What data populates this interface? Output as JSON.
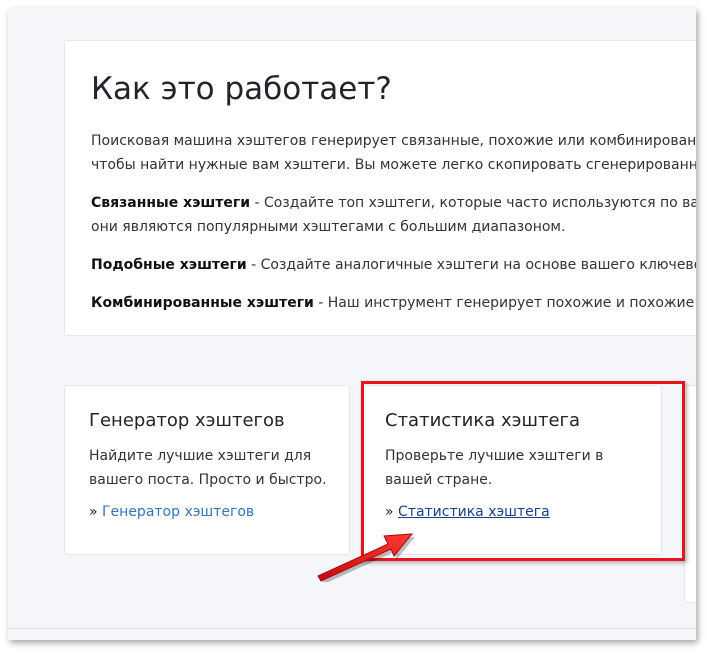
{
  "how_it_works": {
    "title": "Как это работает?",
    "intro_line1": "Поисковая машина хэштегов генерирует связанные, похожие или комбинированные",
    "intro_line2": "чтобы найти нужные вам хэштеги. Вы можете легко скопировать сгенерированные х",
    "related_term": "Связанные хэштеги",
    "related_desc_line1": " - Создайте топ хэштеги, которые часто используются по вашему",
    "related_desc_line2": "они являются популярными хэштегами с большим диапазоном.",
    "similar_term": "Подобные хэштеги",
    "similar_desc": " - Создайте аналогичные хэштеги на основе вашего ключевого сл",
    "combined_term": "Комбинированные хэштеги",
    "combined_desc": " - Наш инструмент генерирует похожие и похожие хэшт"
  },
  "cards": [
    {
      "title": "Генератор хэштегов",
      "description": "Найдите лучшие хэштеги для вашего поста. Просто и быстро.",
      "link_prefix": "» ",
      "link_text": "Генератор хэштегов"
    },
    {
      "title": "Статистика хэштега",
      "description": "Проверьте лучшие хэштеги в вашей стране.",
      "link_prefix": "» ",
      "link_text": "Статистика хэштега"
    }
  ],
  "annotation": {
    "highlight_color": "#e8141d",
    "icon": "red-arrow-icon"
  }
}
